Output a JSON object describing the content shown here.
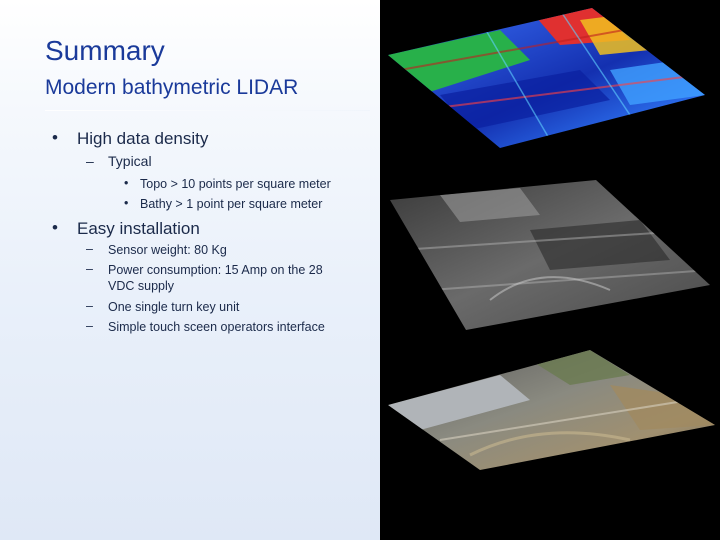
{
  "slide": {
    "title": "Summary",
    "subtitle": "Modern bathymetric LIDAR",
    "bullets": [
      {
        "text": "High data density",
        "sub": [
          {
            "text": "Typical",
            "sub": [
              "Topo > 10 points per square meter",
              "Bathy  > 1 point per square meter"
            ]
          }
        ]
      },
      {
        "text": "Easy installation",
        "sub": [
          {
            "lines": [
              "Sensor weight: 80 Kg"
            ]
          },
          {
            "lines": [
              "Power consumption: 15 Amp on the 28",
              "VDC supply"
            ]
          },
          {
            "lines": [
              "One single turn key unit"
            ]
          },
          {
            "lines": [
              "Simple touch sceen operators interface"
            ]
          }
        ]
      }
    ]
  },
  "images": [
    {
      "icon": "lidar-elevation-color-map-image"
    },
    {
      "icon": "lidar-intensity-grayscale-image"
    },
    {
      "icon": "aerial-orthophoto-image"
    }
  ],
  "colors": {
    "title": "#1a3a9a",
    "text": "#1b2a4a",
    "right_background": "#000000"
  }
}
